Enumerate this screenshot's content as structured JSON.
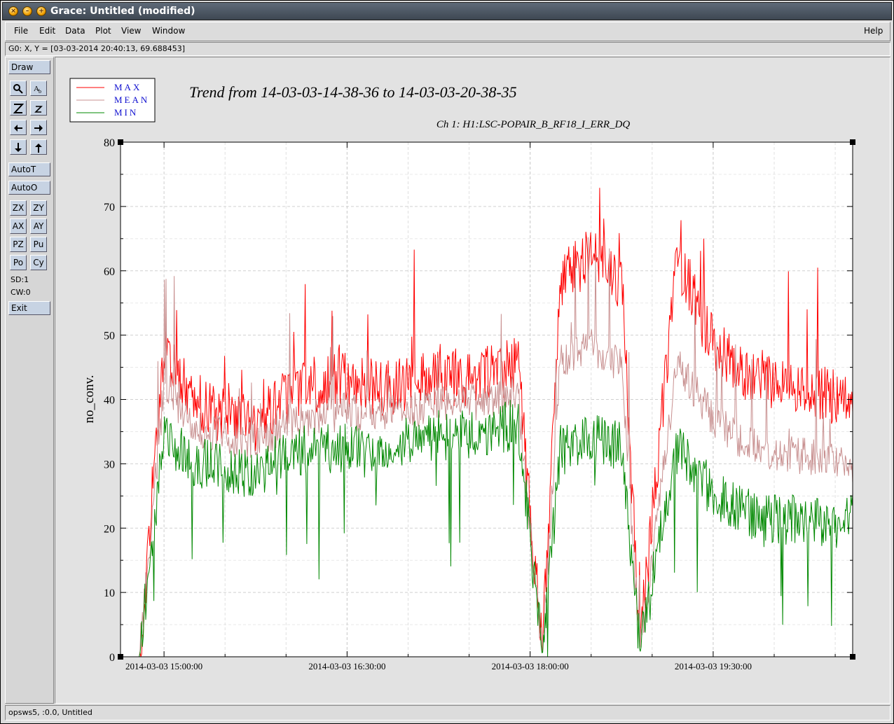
{
  "window": {
    "title": "Grace: Untitled (modified)",
    "title_buttons": [
      "close-icon",
      "minimize-icon",
      "maximize-icon"
    ]
  },
  "menubar": {
    "left": [
      {
        "label": "File",
        "key": "F"
      },
      {
        "label": "Edit",
        "key": "E"
      },
      {
        "label": "Data",
        "key": "D"
      },
      {
        "label": "Plot",
        "key": "P"
      },
      {
        "label": "View",
        "key": "V"
      },
      {
        "label": "Window",
        "key": "W"
      }
    ],
    "help": {
      "label": "Help",
      "key": "H"
    }
  },
  "locator": "G0: X, Y = [03-03-2014 20:40:13, 69.688453]",
  "toolbar": {
    "draw": "Draw",
    "autot": "AutoT",
    "autoo": "AutoO",
    "zx": "ZX",
    "zy": "ZY",
    "ax": "AX",
    "ay": "AY",
    "pz": "PZ",
    "pu": "Pu",
    "po": "Po",
    "cy": "Cy",
    "sd": "SD:1",
    "cw": "CW:0",
    "exit": "Exit",
    "icons": [
      "zoom-icon",
      "text-icon",
      "zoom-in-icon",
      "zoom-out-icon",
      "left-arrow-icon",
      "right-arrow-icon",
      "down-arrow-icon",
      "up-arrow-icon"
    ]
  },
  "statusbar": "opsws5, :0.0, Untitled",
  "chart_data": {
    "type": "line",
    "title": "Trend from 14-03-03-14-38-36 to 14-03-03-20-38-35",
    "subtitle": "Ch 1: H1:LSC-POPAIR_B_RF18_I_ERR_DQ",
    "ylabel": "no_conv.",
    "xlabel": "",
    "ylim": [
      0,
      80
    ],
    "yticks": [
      0,
      10,
      20,
      30,
      40,
      50,
      60,
      70,
      80
    ],
    "x_range": [
      "2014-03-03 14:38:36",
      "2014-03-03 20:38:35"
    ],
    "xtick_labels": [
      "2014-03-03 15:00:00",
      "2014-03-03 16:30:00",
      "2014-03-03 18:00:00",
      "2014-03-03 19:30:00"
    ],
    "grid": true,
    "legend_position": "top-left, outside plot",
    "colors": {
      "MAX": "#ff0000",
      "MEAN": "#c89090",
      "MIN": "#008800"
    },
    "x_hours": [
      14.65,
      14.8,
      15.0,
      15.25,
      15.5,
      15.75,
      16.0,
      16.25,
      16.5,
      16.75,
      17.0,
      17.25,
      17.5,
      17.75,
      17.9,
      18.1,
      18.25,
      18.5,
      18.75,
      18.9,
      19.2,
      19.5,
      19.75,
      20.0,
      20.25,
      20.5,
      20.64
    ],
    "series": [
      {
        "name": "MAX",
        "values": [
          0,
          0,
          48,
          39,
          37,
          36,
          40,
          42,
          43,
          41,
          42,
          43,
          43,
          44,
          45,
          0,
          58,
          62,
          58,
          1,
          62,
          48,
          44,
          42,
          41,
          40,
          38
        ]
      },
      {
        "name": "MEAN",
        "values": [
          0,
          0,
          42,
          35,
          34,
          33,
          36,
          37,
          38,
          37,
          38,
          39,
          39,
          40,
          41,
          0,
          46,
          48,
          45,
          1,
          45,
          37,
          33,
          31,
          31,
          30,
          29
        ]
      },
      {
        "name": "MIN",
        "values": [
          0,
          0,
          34,
          30,
          29,
          28,
          31,
          32,
          32,
          31,
          33,
          34,
          34,
          35,
          36,
          0,
          32,
          34,
          32,
          0.5,
          32,
          25,
          22,
          21,
          21,
          20,
          21
        ]
      }
    ]
  }
}
